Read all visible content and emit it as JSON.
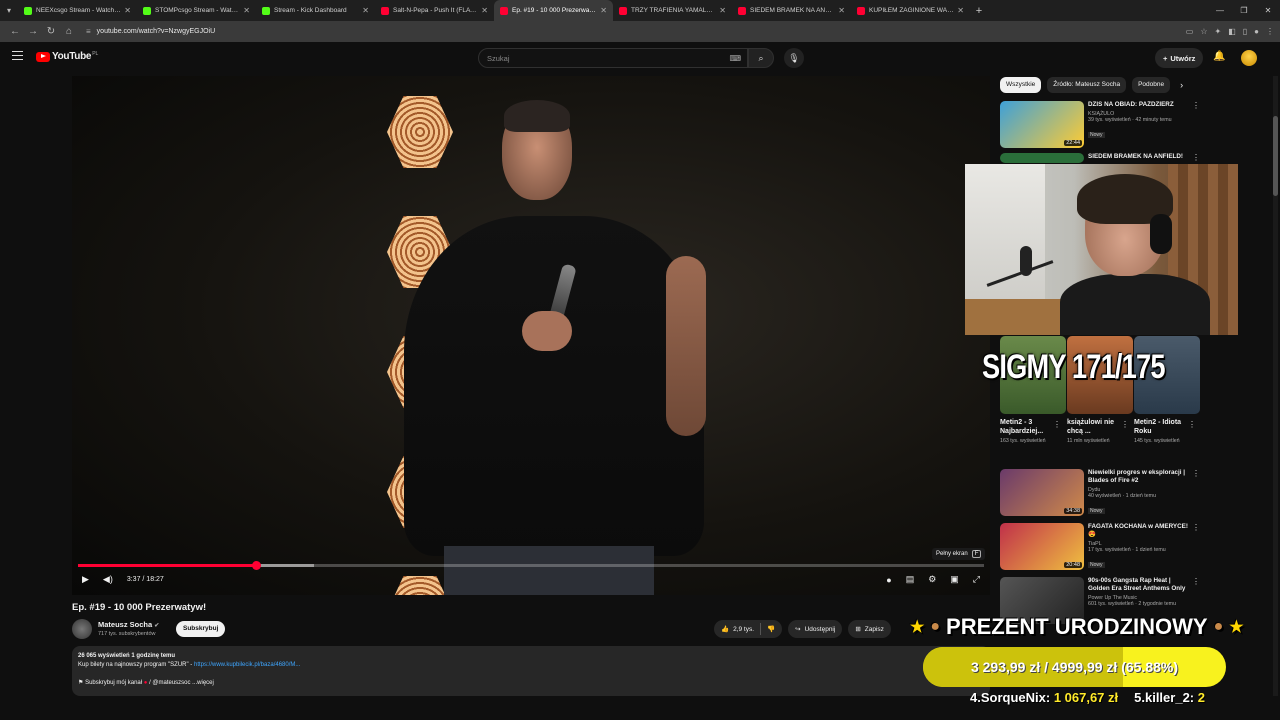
{
  "browser": {
    "tabs": [
      {
        "title": "NEEXcsgo Stream - Watch Live",
        "color": "#53fc18"
      },
      {
        "title": "STOMPcsgo Stream - Watch Live",
        "color": "#53fc18"
      },
      {
        "title": "Stream - Kick Dashboard",
        "color": "#53fc18"
      },
      {
        "title": "Salt-N-Pepa - Push It (FLAVIA)",
        "color": "#ff0033"
      },
      {
        "title": "Ep. #19 - 10 000 Prezerwatyw!",
        "color": "#ff0033",
        "active": true
      },
      {
        "title": "TRZY TRAFIENIA YAMALA! LEW",
        "color": "#ff0033"
      },
      {
        "title": "SIEDEM BRAMEK NA ANFIELD!",
        "color": "#ff0033"
      },
      {
        "title": "KUPIŁEM ZAGINIONE WALIZKI",
        "color": "#ff0033"
      }
    ],
    "url": "youtube.com/watch?v=NzwgyEGJOiU"
  },
  "header": {
    "logo_text": "YouTube",
    "logo_region": "PL",
    "search_placeholder": "Szukaj",
    "create_label": "Utwórz"
  },
  "player": {
    "current_time": "3:37",
    "duration": "18:27",
    "time_display": "3:37 / 18:27",
    "progress_fraction": 0.196,
    "buffered_fraction": 0.26,
    "tooltip_label": "Pełny ekran",
    "tooltip_key": "F"
  },
  "video": {
    "title": "Ep. #19 - 10 000 Prezerwatyw!",
    "channel": "Mateusz Socha",
    "subscribers": "717 tys. subskrybentów",
    "subscribe_label": "Subskrybuj",
    "likes": "2,9 tys.",
    "share_label": "Udostępnij",
    "save_label": "Zapisz",
    "desc_stats": "26 065 wyświetleń  1 godzinę temu",
    "desc_line": "Kup bilety na najnowszy program \"SZUR\" - ",
    "desc_link": "https://www.kupbilecik.pl/baza/4680/M...",
    "desc_sub": "Subskrybuj mój kanał",
    "desc_handle": "/ @mateuszsoc",
    "desc_more": "...więcej"
  },
  "sidebar": {
    "chips": [
      "Wszystkie",
      "Źródło: Mateusz Socha",
      "Podobne"
    ],
    "recommendations": [
      {
        "title": "DZIŚ NA OBIAD: PAŹDZIERZ",
        "channel": "KSIĄŻULO",
        "views": "39 tys. wyświetleń · 42 minuty temu",
        "badge": "Nowy",
        "duration": "22:44",
        "color": "#3ea0d8"
      },
      {
        "title": "SIEDEM BRAMEK NA ANFIELD!",
        "channel": "",
        "views": "",
        "badge": "",
        "duration": "",
        "color": "#2a6e3a"
      }
    ],
    "shorts": [
      {
        "title": "Metin2 - 3 Najbardziej...",
        "views": "163 tys. wyświetleń",
        "color": "#4a7a3a"
      },
      {
        "title": "książulowi nie chcą ...",
        "views": "11 mln wyświetleń",
        "color": "#a3603a"
      },
      {
        "title": "Metin2 - Idiota Roku",
        "views": "145 tys. wyświetleń",
        "color": "#3a4a5a"
      }
    ],
    "recommendations2": [
      {
        "title": "Niewielki progres w eksploracji | Blades of Fire #2",
        "channel": "Dydu",
        "views": "40 wyświetleń · 1 dzień temu",
        "badge": "Nowy",
        "duration": "34:38",
        "color": "#6a3a6a"
      },
      {
        "title": "FAGATA KOCHANA w AMERYCE!😍",
        "channel": "TiaPL",
        "views": "17 tys. wyświetleń · 1 dzień temu",
        "badge": "Nowy",
        "duration": "20:48",
        "color": "#c0304a"
      },
      {
        "title": "90s-00s Gangsta Rap Heat | Golden Era Street Anthems Only",
        "channel": "Power Up The Music",
        "views": "601 tys. wyświetleń · 2 tygodnie temu",
        "badge": "",
        "duration": "",
        "color": "#555555"
      }
    ]
  },
  "overlay": {
    "counter_text": "SIGMY 171/175",
    "prezent_text": "PREZENT URODZINOWY",
    "goal_current": "3 293,99 zł",
    "goal_target": "4999,99 zł",
    "goal_percent": "(65.88%)",
    "goal_fraction": 0.6588,
    "leaders": [
      {
        "name": "4.SorqueNix:",
        "amount": "1 067,67 zł"
      },
      {
        "name": "5.killer_2:",
        "amount": "2"
      }
    ]
  }
}
